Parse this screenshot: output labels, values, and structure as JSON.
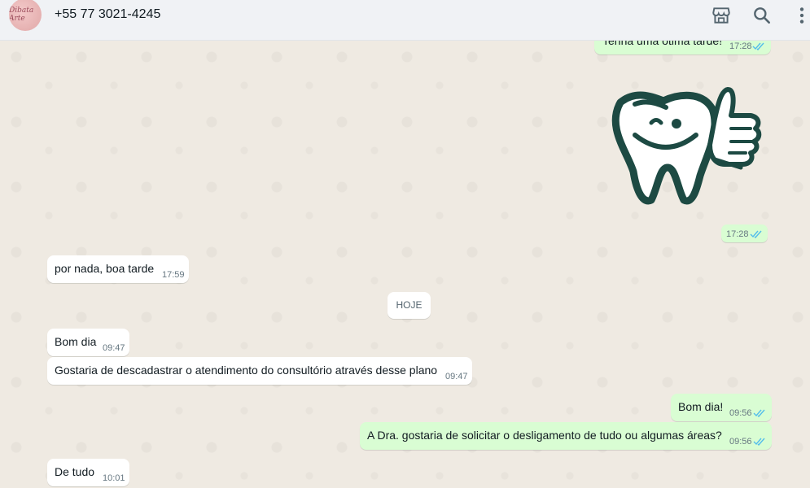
{
  "header": {
    "contact_name": "+55 77 3021-4245",
    "avatar_text": "Dibata Arte",
    "icons": [
      "store-icon",
      "search-icon",
      "menu-icon"
    ]
  },
  "day_separator": "HOJE",
  "messages": [
    {
      "direction": "out",
      "text": "Tenha uma ótima tarde!",
      "time": "17:28",
      "status": "read"
    },
    {
      "direction": "out",
      "type": "sticker",
      "sticker": "tooth-thumbs-up-sticker",
      "time": "17:28",
      "status": "read"
    },
    {
      "direction": "in",
      "text": "por nada, boa tarde",
      "time": "17:59"
    },
    {
      "direction": "in",
      "text": "Bom dia",
      "time": "09:47"
    },
    {
      "direction": "in",
      "text": "Gostaria de descadastrar o atendimento do consultório através desse plano",
      "time": "09:47"
    },
    {
      "direction": "out",
      "text": "Bom dia!",
      "time": "09:56",
      "status": "read"
    },
    {
      "direction": "out",
      "text": "A Dra. gostaria de solicitar o desligamento de tudo ou algumas áreas?",
      "time": "09:56",
      "status": "read"
    },
    {
      "direction": "in",
      "text": "De tudo",
      "time": "10:01"
    }
  ],
  "colors": {
    "chat_background": "#efeae2",
    "incoming_bubble": "#ffffff",
    "outgoing_bubble": "#d9fdd3",
    "read_ticks": "#53bdeb",
    "header_background": "#f0f2f5",
    "sticker_color": "#1d4a43"
  }
}
